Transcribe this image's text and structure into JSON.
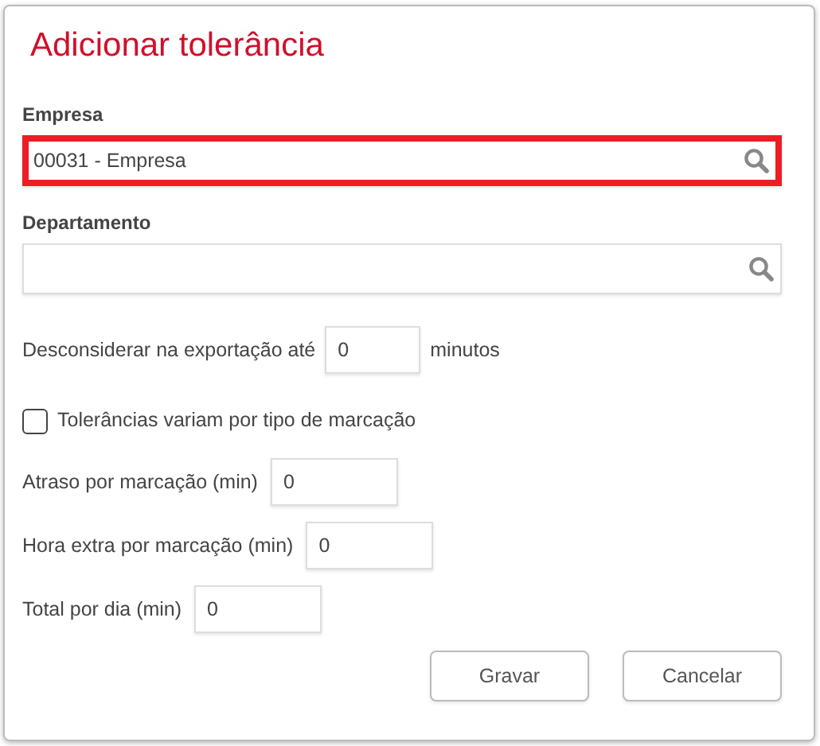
{
  "dialog": {
    "title": "Adicionar tolerância"
  },
  "lookup_fields": [
    {
      "label": "Empresa",
      "value": "00031 - Empresa",
      "highlighted": true
    },
    {
      "label": "Departamento",
      "highlighted": false
    }
  ],
  "export_row": {
    "label": "Desconsiderar na exportação até",
    "value": "0",
    "unit": "minutos"
  },
  "checkbox": {
    "label": "Tolerâncias variam por tipo de marcação",
    "checked": false
  },
  "number_fields": [
    {
      "label": "Atraso por marcação (min)",
      "value": "0"
    },
    {
      "label": "Hora extra por marcação (min)",
      "value": "0"
    },
    {
      "label": "Total por dia (min)",
      "value": "0"
    }
  ],
  "buttons": [
    "Gravar",
    "Cancelar"
  ]
}
